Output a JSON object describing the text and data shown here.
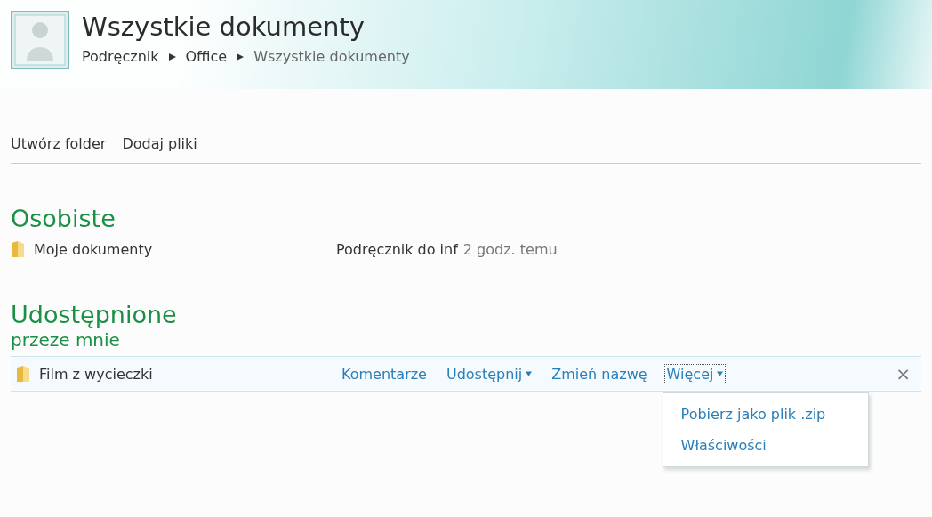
{
  "header": {
    "title": "Wszystkie dokumenty",
    "breadcrumb": [
      {
        "label": "Podręcznik",
        "current": false
      },
      {
        "label": "Office",
        "current": false
      },
      {
        "label": "Wszystkie dokumenty",
        "current": true
      }
    ]
  },
  "toolbar": [
    "Utwórz folder",
    "Dodaj pliki"
  ],
  "personal": {
    "heading": "Osobiste",
    "items": [
      {
        "name": "Moje dokumenty",
        "detail": "Podręcznik do inf",
        "time": "2 godz. temu"
      }
    ]
  },
  "shared": {
    "heading": "Udostępnione",
    "subheading": "przeze mnie",
    "items": [
      {
        "name": "Film z wycieczki",
        "selected": true,
        "actions": [
          {
            "label": "Komentarze",
            "has_menu": false,
            "open": false
          },
          {
            "label": "Udostępnij",
            "has_menu": true,
            "open": false
          },
          {
            "label": "Zmień nazwę",
            "has_menu": false,
            "open": false
          },
          {
            "label": "Więcej",
            "has_menu": true,
            "open": true
          }
        ],
        "close": "×",
        "menu": [
          "Pobierz jako plik .zip",
          "Właściwości"
        ]
      }
    ]
  }
}
